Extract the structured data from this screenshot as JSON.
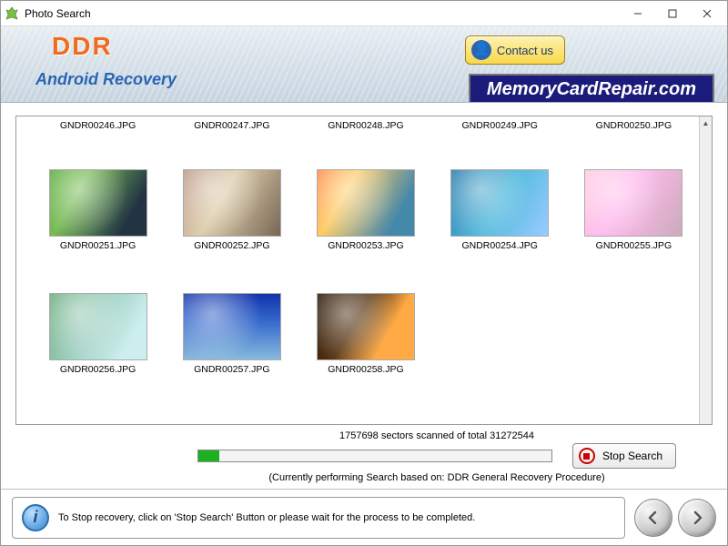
{
  "window": {
    "title": "Photo Search"
  },
  "header": {
    "brand": "DDR",
    "brand_sub": "Android Recovery",
    "contact_label": "Contact us",
    "site_label": "MemoryCardRepair.com"
  },
  "thumbs": {
    "row1": [
      "GNDR00246.JPG",
      "GNDR00247.JPG",
      "GNDR00248.JPG",
      "GNDR00249.JPG",
      "GNDR00250.JPG"
    ],
    "row2": [
      "GNDR00251.JPG",
      "GNDR00252.JPG",
      "GNDR00253.JPG",
      "GNDR00254.JPG",
      "GNDR00255.JPG"
    ],
    "row3": [
      "GNDR00256.JPG",
      "GNDR00257.JPG",
      "GNDR00258.JPG"
    ]
  },
  "progress": {
    "label": "1757698 sectors scanned of total 31272544",
    "sub": "(Currently performing Search based on:  DDR General Recovery Procedure)",
    "percent": 5.6,
    "stop_label": "Stop Search"
  },
  "footer": {
    "info_text": "To Stop recovery, click on 'Stop Search' Button or please wait for the process to be completed."
  }
}
